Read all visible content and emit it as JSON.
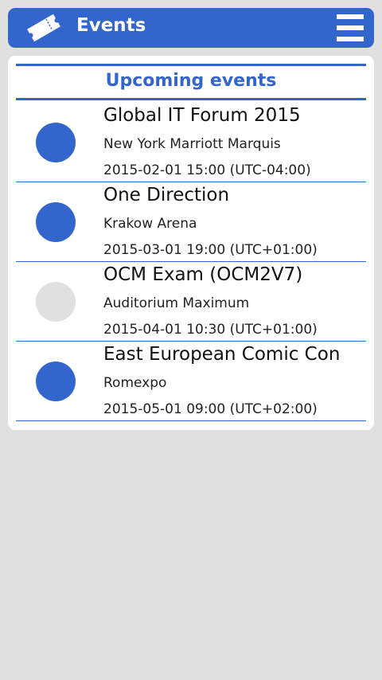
{
  "app": {
    "title": "Events",
    "icon": "ticket-icon",
    "menu_icon": "hamburger-menu-icon"
  },
  "section": {
    "title": "Upcoming events"
  },
  "colors": {
    "accent": "#3366cc",
    "background": "#e0e0e0",
    "inactive": "#e0e0e0"
  },
  "events": [
    {
      "name": "Global IT Forum 2015",
      "venue": "New York Marriott Marquis",
      "datetime": "2015-02-01 15:00 (UTC-04:00)",
      "status_color": "#3366cc"
    },
    {
      "name": "One Direction",
      "venue": "Krakow Arena",
      "datetime": "2015-03-01 19:00 (UTC+01:00)",
      "status_color": "#3366cc"
    },
    {
      "name": "OCM Exam (OCM2V7)",
      "venue": "Auditorium Maximum",
      "datetime": "2015-04-01 10:30 (UTC+01:00)",
      "status_color": "#e0e0e0"
    },
    {
      "name": "East European Comic Con",
      "venue": "Romexpo",
      "datetime": "2015-05-01 09:00 (UTC+02:00)",
      "status_color": "#3366cc"
    }
  ]
}
